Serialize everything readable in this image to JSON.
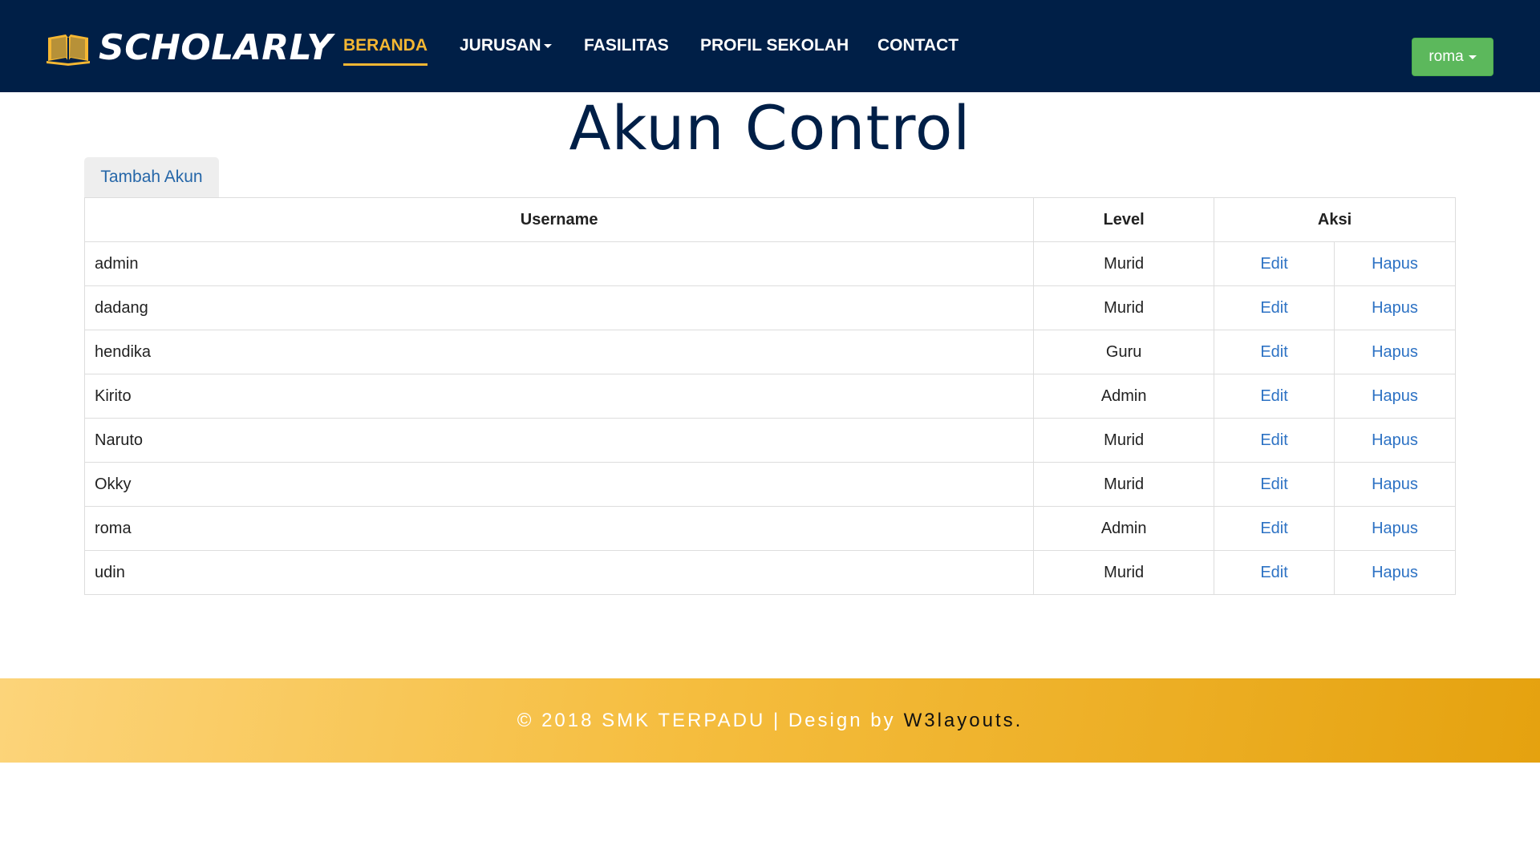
{
  "brand": {
    "name": "SCHOLARLY"
  },
  "nav": {
    "items": [
      {
        "label": "BERANDA",
        "active": true
      },
      {
        "label": "JURUSAN",
        "dropdown": true
      },
      {
        "label": "FASILITAS"
      },
      {
        "label": "PROFIL SEKOLAH"
      },
      {
        "label": "CONTACT"
      }
    ]
  },
  "user_menu": {
    "label": "roma"
  },
  "page": {
    "title": "Akun Control"
  },
  "toolbar": {
    "add_label": "Tambah Akun"
  },
  "table": {
    "headers": {
      "username": "Username",
      "level": "Level",
      "actions": "Aksi"
    },
    "action_labels": {
      "edit": "Edit",
      "delete": "Hapus"
    },
    "rows": [
      {
        "username": "admin",
        "level": "Murid",
        "edit": "Edit",
        "delete": "Hapus"
      },
      {
        "username": "dadang",
        "level": "Murid",
        "edit": "Edit",
        "delete": "Hapus"
      },
      {
        "username": "hendika",
        "level": "Guru",
        "edit": "Edit",
        "delete": "Hapus"
      },
      {
        "username": "Kirito",
        "level": "Admin",
        "edit": "Edit",
        "delete": "Hapus"
      },
      {
        "username": "Naruto",
        "level": "Murid",
        "edit": "Edit",
        "delete": "Hapus"
      },
      {
        "username": "Okky",
        "level": "Murid",
        "edit": "Edit",
        "delete": "Hapus"
      },
      {
        "username": "roma",
        "level": "Admin",
        "edit": "Edit",
        "delete": "Hapus"
      },
      {
        "username": "udin",
        "level": "Murid",
        "edit": "Edit",
        "delete": "Hapus"
      }
    ]
  },
  "footer": {
    "copyright": "© 2018 SMK TERPADU | Design by",
    "credit": "W3layouts."
  },
  "colors": {
    "navbar": "#001f47",
    "accent": "#f5b733",
    "user_button": "#5cb85c",
    "link": "#2d72c4",
    "footer_start": "#fcd47a",
    "footer_end": "#e5a20f"
  },
  "icons": {
    "logo": "open-book-icon",
    "caret": "caret-down-icon"
  }
}
